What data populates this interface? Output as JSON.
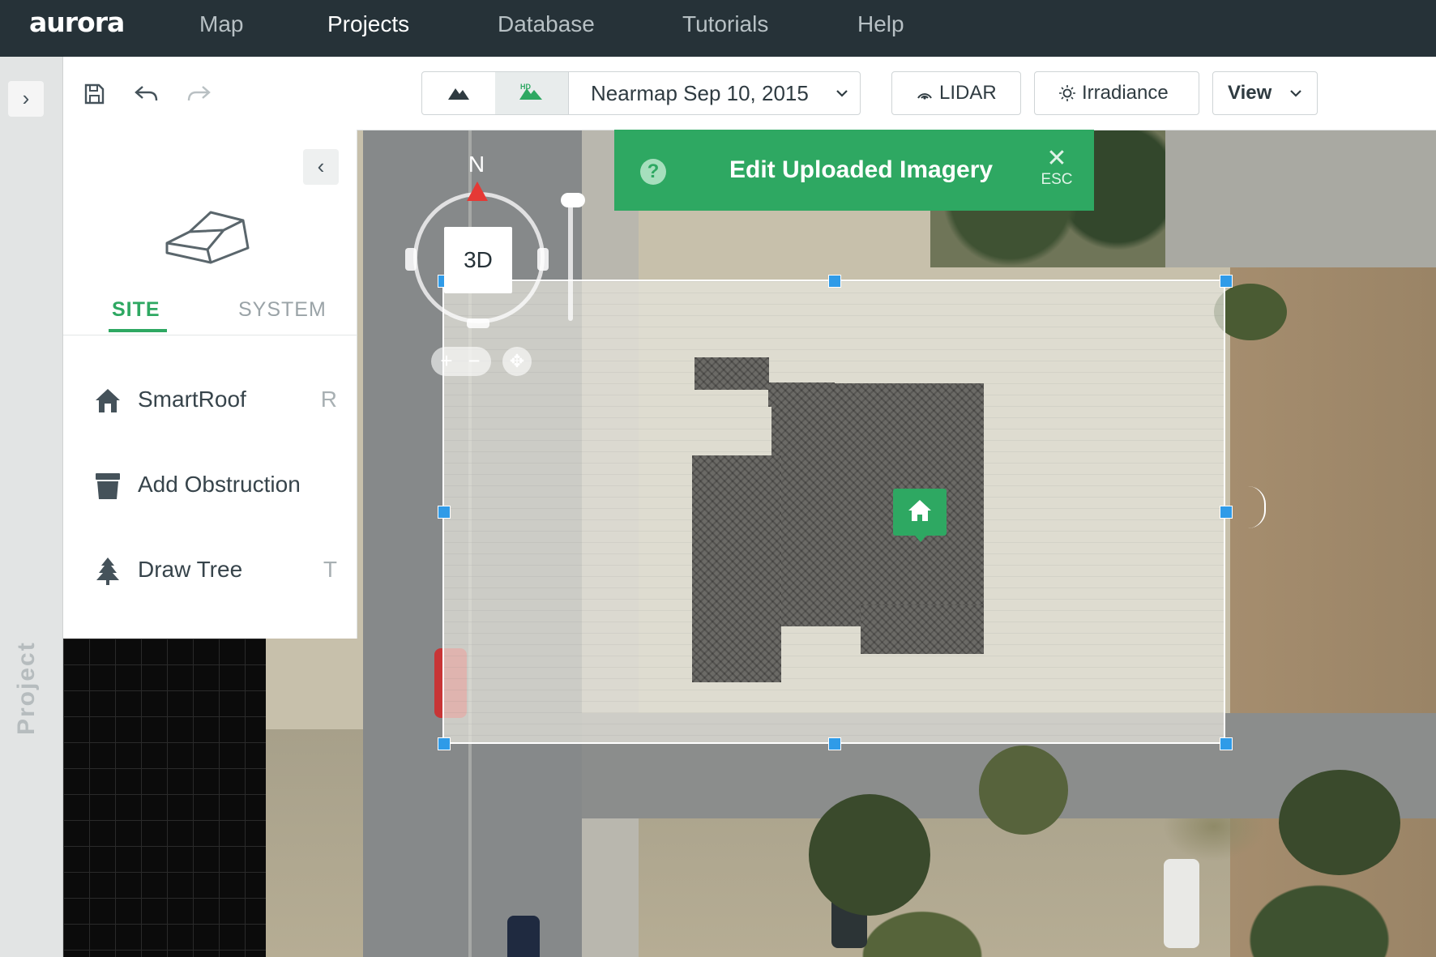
{
  "app": {
    "logo": "aurora"
  },
  "nav": {
    "items": [
      {
        "label": "Map",
        "active": false
      },
      {
        "label": "Projects",
        "active": true
      },
      {
        "label": "Database",
        "active": false
      },
      {
        "label": "Tutorials",
        "active": false
      },
      {
        "label": "Help",
        "active": false
      }
    ]
  },
  "rail": {
    "expand_icon": "›",
    "label": "Project"
  },
  "toolbar": {
    "save_icon": "save-icon",
    "undo_icon": "undo-icon",
    "redo_icon": "redo-icon",
    "imagery_date": "Nearmap Sep 10, 2015",
    "lidar_label": "LIDAR",
    "irradiance_label": "Irradiance",
    "view_label": "View"
  },
  "panel": {
    "collapse_icon": "‹",
    "tabs": {
      "site": "SITE",
      "system": "SYSTEM"
    },
    "tools": [
      {
        "label": "SmartRoof",
        "shortcut": "R",
        "icon": "smartroof-icon"
      },
      {
        "label": "Add Obstruction",
        "shortcut": "",
        "icon": "obstruction-icon"
      },
      {
        "label": "Draw Tree",
        "shortcut": "T",
        "icon": "tree-icon"
      }
    ]
  },
  "banner": {
    "help_icon": "?",
    "title": "Edit Uploaded Imagery",
    "close_icon": "✕",
    "close_hint": "ESC"
  },
  "map_controls": {
    "north_label": "N",
    "view_3d_label": "3D",
    "zoom_in": "+",
    "zoom_out": "−"
  },
  "colors": {
    "accent_green": "#2ea862",
    "nav_bg": "#263238",
    "handle_blue": "#2f9be8",
    "compass_red": "#e53935"
  }
}
